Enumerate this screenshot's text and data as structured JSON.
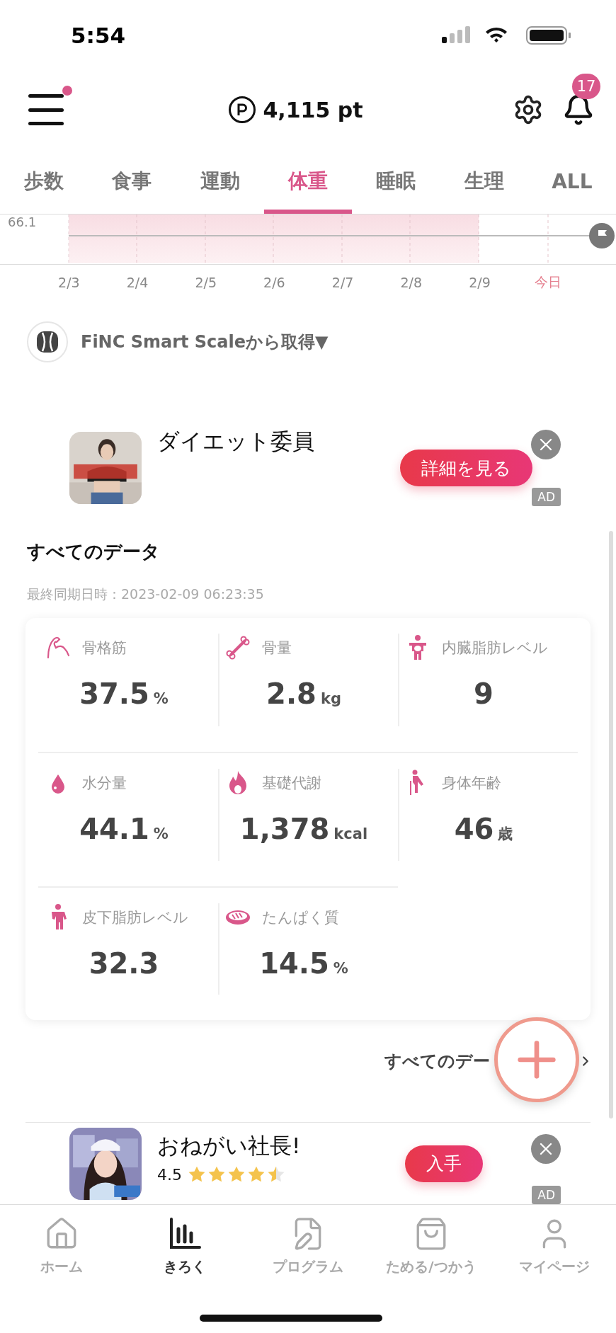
{
  "status_bar": {
    "time": "5:54"
  },
  "header": {
    "menu_has_dot": true,
    "points": "4,115 pt",
    "notification_count": "17"
  },
  "tabs": [
    {
      "label": "歩数",
      "selected": false
    },
    {
      "label": "食事",
      "selected": false
    },
    {
      "label": "運動",
      "selected": false
    },
    {
      "label": "体重",
      "selected": true
    },
    {
      "label": "睡眠",
      "selected": false
    },
    {
      "label": "生理",
      "selected": false
    },
    {
      "label": "ALL",
      "selected": false
    }
  ],
  "chart": {
    "y_label": "66.1",
    "x_labels": [
      {
        "label": "2/3",
        "kind": "date"
      },
      {
        "label": "2/4",
        "kind": "date"
      },
      {
        "label": "2/5",
        "kind": "date"
      },
      {
        "label": "2/6",
        "kind": "date"
      },
      {
        "label": "2/7",
        "kind": "date"
      },
      {
        "label": "2/8",
        "kind": "date"
      },
      {
        "label": "2/9",
        "kind": "date"
      },
      {
        "label": "今日",
        "kind": "today"
      }
    ]
  },
  "source": {
    "label": "FiNC Smart Scaleから取得▼"
  },
  "ad_top": {
    "title": "ダイエット委員",
    "button": "詳細を見る",
    "badge": "AD"
  },
  "all_data": {
    "title": "すべてのデータ",
    "synced": "最終同期日時：2023-02-09 06:23:35",
    "metrics": [
      {
        "label": "骨格筋",
        "value": "37.5",
        "unit": "%"
      },
      {
        "label": "骨量",
        "value": "2.8",
        "unit": "kg"
      },
      {
        "label": "内臓脂肪レベル",
        "value": "9"
      },
      {
        "label": "水分量",
        "value": "44.1",
        "unit": "%"
      },
      {
        "label": "基礎代謝",
        "value": "1,378",
        "unit": "kcal"
      },
      {
        "label": "身体年齢",
        "value": "46",
        "unit": "歳"
      },
      {
        "label": "皮下脂肪レベル",
        "value": "32.3"
      },
      {
        "label": "たんぱく質",
        "value": "14.5",
        "unit": "%"
      }
    ],
    "link": "すべてのデー"
  },
  "ad_bottom": {
    "title": "おねがい社長!",
    "rating": "4.5",
    "stars": 4.5,
    "button": "入手",
    "badge": "AD"
  },
  "bottom_nav": [
    {
      "label": "ホーム",
      "selected": false
    },
    {
      "label": "きろく",
      "selected": true
    },
    {
      "label": "プログラム",
      "selected": false
    },
    {
      "label": "ためる/つかう",
      "selected": false
    },
    {
      "label": "マイページ",
      "selected": false
    }
  ]
}
